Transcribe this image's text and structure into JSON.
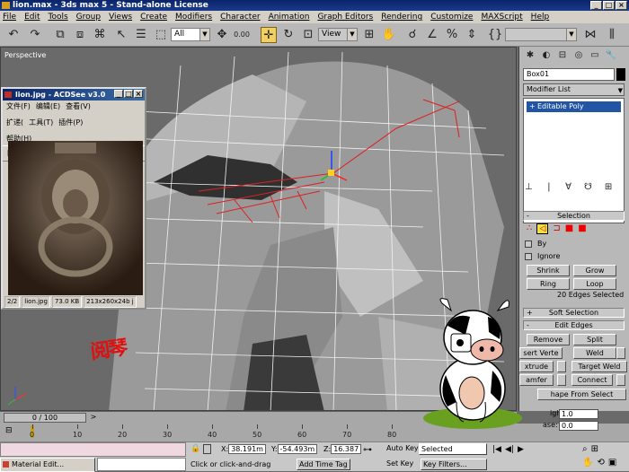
{
  "window": {
    "title": "lion.max - 3ds max 5 - Stand-alone License",
    "min": "_",
    "max": "□",
    "close": "×"
  },
  "menu": [
    "File",
    "Edit",
    "Tools",
    "Group",
    "Views",
    "Create",
    "Modifiers",
    "Character",
    "Animation",
    "Graph Editors",
    "Rendering",
    "Customize",
    "MAXScript",
    "Help"
  ],
  "toolbar": {
    "selection_filter": "All",
    "coord_system": "View",
    "spinner_value": "0.00"
  },
  "viewport": {
    "label": "Perspective"
  },
  "acdsee": {
    "title": "lion.jpg - ACDSee v3.0",
    "menu": [
      "文件(F)",
      "编辑(E)",
      "查看(V)",
      "扩递(",
      "工具(T)",
      "插件(P)",
      "帮助(H)"
    ],
    "status": {
      "index": "2/2",
      "filename": "lion.jpg",
      "size": "73.0 KB",
      "dims": "213x260x24b j"
    }
  },
  "stamp": "阅琴",
  "panel": {
    "object_name": "Box01",
    "modifier_list": "Modifier List",
    "stack_item": "Editable Poly",
    "selection_rollout": "Selection",
    "by_label": "By",
    "ignore_label": "Ignore",
    "shrink": "Shrink",
    "grow": "Grow",
    "ring": "Ring",
    "loop": "Loop",
    "edges_selected": "20 Edges Selected",
    "soft_selection": "Soft Selection",
    "edit_edges": "Edit Edges",
    "remove": "Remove",
    "split": "Split",
    "insert_vertex": "sert Verte",
    "weld": "Weld",
    "extrude": "xtrude",
    "target_weld": "Target Weld",
    "chamfer": "amfer",
    "connect": "Connect",
    "shape_from": "hape From Select",
    "spinner1_label": "ight:",
    "spinner1": "1.0",
    "spinner2_label": "ase:",
    "spinner2": "0.0"
  },
  "time": {
    "slider": "0 / 100",
    "ticks": [
      "0",
      "10",
      "20",
      "30",
      "40",
      "50",
      "60",
      "70",
      "80"
    ]
  },
  "status": {
    "x_label": "X:",
    "x": "38.191m",
    "y_label": "Y:",
    "y": "-54.493m",
    "z_label": "Z:",
    "z": "16.387",
    "prompt": "Click or click-and-drag",
    "add_time_tag": "Add Time Tag",
    "auto_key": "Auto Key",
    "selected": "Selected",
    "set_key": "Set Key",
    "key_filters": "Key Filters...",
    "task": "Material Edit..."
  }
}
